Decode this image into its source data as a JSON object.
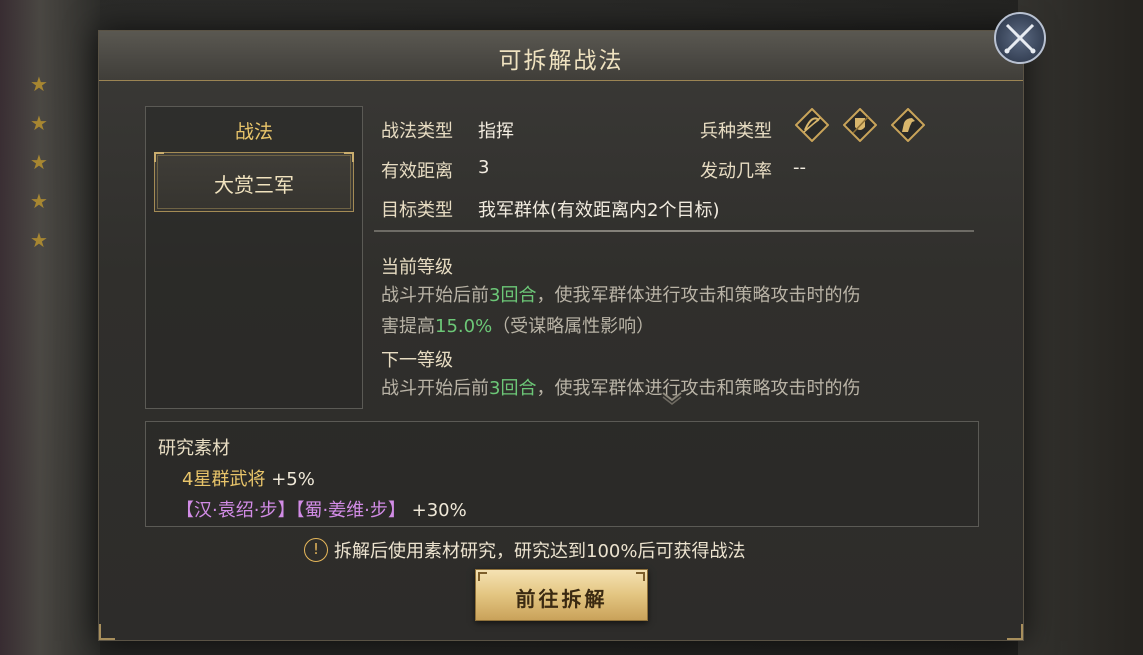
{
  "dialog": {
    "title": "可拆解战法"
  },
  "left_panel": {
    "header": "战法",
    "selected_skill": "大赏三军"
  },
  "info": {
    "skill_type_label": "战法类型",
    "skill_type_value": "指挥",
    "troop_type_label": "兵种类型",
    "troop_icons": [
      "bow-cavalry-icon",
      "shield-infantry-icon",
      "horse-cavalry-icon"
    ],
    "range_label": "有效距离",
    "range_value": "3",
    "trigger_rate_label": "发动几率",
    "trigger_rate_value": "--",
    "target_label": "目标类型",
    "target_value": "我军群体(有效距离内2个目标)"
  },
  "description": {
    "current_level_title": "当前等级",
    "current_text_1": "战斗开始后前",
    "current_rounds": "3回合",
    "current_text_2": "，使我军群体进行攻击和策略攻击时的伤",
    "current_text_3": "害提高",
    "current_percent": "15.0%",
    "current_text_4": "（受谋略属性影响）",
    "next_level_title": "下一等级",
    "next_text_1": "战斗开始后前",
    "next_rounds": "3回合",
    "next_text_2": "，使我军群体进行攻击和策略攻击时的伤"
  },
  "materials": {
    "title": "研究素材",
    "line1_name": "4星群武将",
    "line1_bonus": "+5%",
    "line2_item1": "【汉·袁绍·步】",
    "line2_item2": "【蜀·姜维·步】",
    "line2_bonus": "+30%"
  },
  "notice": {
    "icon": "!",
    "text": "拆解后使用素材研究，研究达到100%后可获得战法"
  },
  "action": {
    "label": "前往拆解"
  },
  "colors": {
    "gold": "#e8c46a",
    "highlight_green": "#6cc777",
    "purple": "#d28ce6",
    "button_gold": "#e3c581"
  }
}
